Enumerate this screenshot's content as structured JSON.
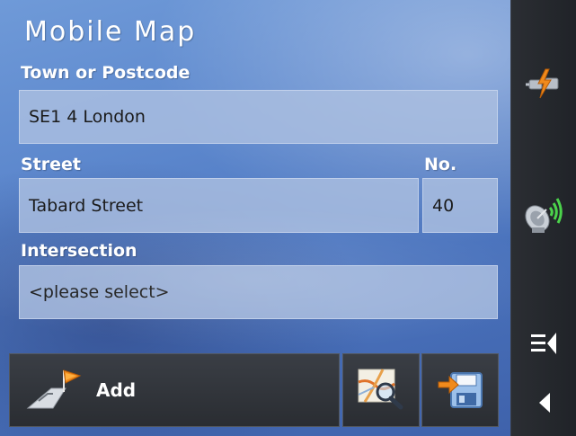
{
  "app": {
    "title": "Mobile Map"
  },
  "form": {
    "town_label": "Town or Postcode",
    "town_value": "SE1 4 London",
    "street_label": "Street",
    "street_value": "Tabard Street",
    "number_label": "No.",
    "number_value": "40",
    "intersection_label": "Intersection",
    "intersection_value": "<please select>"
  },
  "toolbar": {
    "add_label": "Add"
  },
  "icons": {
    "connection": "plug-connection-icon",
    "gps": "satellite-dish-icon",
    "menu": "menu-list-icon",
    "back": "back-arrow-icon",
    "add": "route-flag-icon",
    "map_search": "map-magnifier-icon",
    "save": "save-floppy-icon"
  },
  "colors": {
    "panel_blue": "#5b86cc",
    "field_fill": "#acc0e0",
    "sidebar": "#23262b",
    "accent_orange": "#f08a1c",
    "gps_green": "#4bd34b"
  }
}
